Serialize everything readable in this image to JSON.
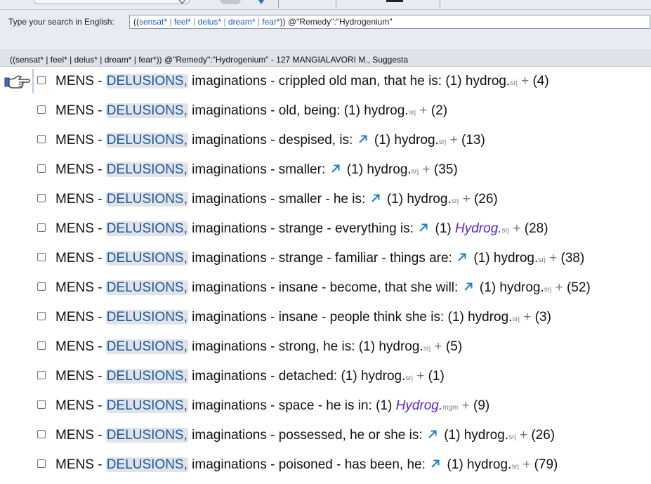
{
  "search": {
    "label": "Type your search in English:",
    "query_parts": [
      {
        "text": "((",
        "style": "dark"
      },
      {
        "text": "sensat*",
        "style": "blue"
      },
      {
        "text": " | ",
        "style": "gray"
      },
      {
        "text": "feel*",
        "style": "blue"
      },
      {
        "text": " | ",
        "style": "gray"
      },
      {
        "text": "delus*",
        "style": "blue"
      },
      {
        "text": " | ",
        "style": "gray"
      },
      {
        "text": "dream*",
        "style": "blue"
      },
      {
        "text": " | ",
        "style": "gray"
      },
      {
        "text": "fear*",
        "style": "blue"
      },
      {
        "text": ")) @\"Remedy\":\"Hydrogenium\"",
        "style": "dark"
      }
    ]
  },
  "result_header": "((sensat* | feel* | delus* | dream* | fear*)) @\"Remedy\":\"Hydrogenium\"  - 127 MANGIALAVORI M., Suggesta",
  "rows": [
    {
      "section": "MENS",
      "sep1": " - ",
      "keyword": "DELUSIONS,",
      "rest": " imaginations - crippled old man, that he is:",
      "arrow": false,
      "grade": "(1)",
      "remedy": "hydrog.",
      "italic": false,
      "abbr": "srj",
      "plus": "+",
      "count": "(4)"
    },
    {
      "section": "MENS",
      "sep1": " - ",
      "keyword": "DELUSIONS,",
      "rest": " imaginations - old, being:",
      "arrow": false,
      "grade": "(1)",
      "remedy": "hydrog.",
      "italic": false,
      "abbr": "srj",
      "plus": "+",
      "count": "(2)"
    },
    {
      "section": "MENS",
      "sep1": " - ",
      "keyword": "DELUSIONS,",
      "rest": " imaginations - despised, is:",
      "arrow": true,
      "grade": "(1)",
      "remedy": "hydrog.",
      "italic": false,
      "abbr": "srj",
      "plus": "+",
      "count": "(13)"
    },
    {
      "section": "MENS",
      "sep1": " - ",
      "keyword": "DELUSIONS,",
      "rest": " imaginations - smaller:",
      "arrow": true,
      "grade": "(1)",
      "remedy": "hydrog.",
      "italic": false,
      "abbr": "srj",
      "plus": "+",
      "count": "(35)"
    },
    {
      "section": "MENS",
      "sep1": " - ",
      "keyword": "DELUSIONS,",
      "rest": " imaginations - smaller - he is:",
      "arrow": true,
      "grade": "(1)",
      "remedy": "hydrog.",
      "italic": false,
      "abbr": "srj",
      "plus": "+",
      "count": "(26)"
    },
    {
      "section": "MENS",
      "sep1": " - ",
      "keyword": "DELUSIONS,",
      "rest": " imaginations - strange - everything is:",
      "arrow": true,
      "grade": "(1)",
      "remedy": "Hydrog.",
      "italic": true,
      "abbr": "srj",
      "plus": "+",
      "count": "(28)"
    },
    {
      "section": "MENS",
      "sep1": " - ",
      "keyword": "DELUSIONS,",
      "rest": " imaginations - strange - familiar - things are:",
      "arrow": true,
      "grade": "(1)",
      "remedy": "hydrog.",
      "italic": false,
      "abbr": "srj",
      "plus": "+",
      "count": "(38)"
    },
    {
      "section": "MENS",
      "sep1": " - ",
      "keyword": "DELUSIONS,",
      "rest": " imaginations - insane - become, that she will:",
      "arrow": true,
      "grade": "(1)",
      "remedy": "hydrog.",
      "italic": false,
      "abbr": "srj",
      "plus": "+",
      "count": "(52)"
    },
    {
      "section": "MENS",
      "sep1": " - ",
      "keyword": "DELUSIONS,",
      "rest": " imaginations - insane - people think she is:",
      "arrow": false,
      "grade": "(1)",
      "remedy": "hydrog.",
      "italic": false,
      "abbr": "srj",
      "plus": "+",
      "count": "(3)"
    },
    {
      "section": "MENS",
      "sep1": " - ",
      "keyword": "DELUSIONS,",
      "rest": " imaginations - strong, he is:",
      "arrow": false,
      "grade": "(1)",
      "remedy": "hydrog.",
      "italic": false,
      "abbr": "srj",
      "plus": "+",
      "count": "(5)"
    },
    {
      "section": "MENS",
      "sep1": " - ",
      "keyword": "DELUSIONS,",
      "rest": " imaginations - detached:",
      "arrow": false,
      "grade": "(1)",
      "remedy": "hydrog.",
      "italic": false,
      "abbr": "srj",
      "plus": "+",
      "count": "(1)"
    },
    {
      "section": "MENS",
      "sep1": " - ",
      "keyword": "DELUSIONS,",
      "rest": " imaginations - space - he is in:",
      "arrow": false,
      "grade": "(1)",
      "remedy": "Hydrog.",
      "italic": true,
      "abbr": "mgm",
      "plus": "+",
      "count": "(9)"
    },
    {
      "section": "MENS",
      "sep1": " - ",
      "keyword": "DELUSIONS,",
      "rest": " imaginations - possessed, he or she is:",
      "arrow": true,
      "grade": "(1)",
      "remedy": "hydrog.",
      "italic": false,
      "abbr": "srj",
      "plus": "+",
      "count": "(26)"
    },
    {
      "section": "MENS",
      "sep1": " - ",
      "keyword": "DELUSIONS,",
      "rest": " imaginations - poisoned - has been, he:",
      "arrow": true,
      "grade": "(1)",
      "remedy": "hydrog.",
      "italic": false,
      "abbr": "srj",
      "plus": "+",
      "count": "(79)"
    }
  ],
  "icons": {
    "row_pointer": "pointing-hand-icon",
    "cross_reference": "northeast-arrow-icon"
  },
  "colors": {
    "keyword": "#1a5a9c",
    "keyword_bg": "#e1e3e8",
    "arrow": "#1a7fc7",
    "italic_remedy": "#5a1fd1",
    "query_term": "#1c5fc2",
    "toolbar_bg": "#e9ebf2"
  }
}
